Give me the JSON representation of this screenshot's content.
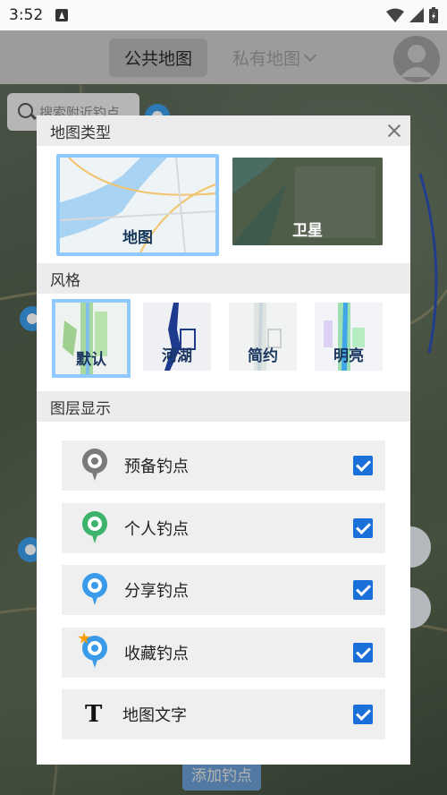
{
  "status_bar": {
    "time": "3:52"
  },
  "top_nav": {
    "tabs": [
      {
        "label": "公共地图",
        "selected": true
      },
      {
        "label": "私有地图",
        "selected": false
      }
    ]
  },
  "map": {
    "search_placeholder": "搜索附近钓点",
    "add_spot_label": "添加钓点"
  },
  "dialog": {
    "map_type_title": "地图类型",
    "map_types": [
      {
        "label": "地图",
        "selected": true
      },
      {
        "label": "卫星",
        "selected": false
      }
    ],
    "style_title": "风格",
    "styles": [
      {
        "label": "默认",
        "selected": true
      },
      {
        "label": "河湖",
        "selected": false
      },
      {
        "label": "简约",
        "selected": false
      },
      {
        "label": "明亮",
        "selected": false
      }
    ],
    "layer_title": "图层显示",
    "layers": [
      {
        "label": "预备钓点",
        "checked": true,
        "icon": "reserve-spot-pin-icon",
        "color": "#7a7a7a"
      },
      {
        "label": "个人钓点",
        "checked": true,
        "icon": "personal-spot-pin-icon",
        "color": "#3db36c"
      },
      {
        "label": "分享钓点",
        "checked": true,
        "icon": "shared-spot-pin-icon",
        "color": "#3a9bea"
      },
      {
        "label": "收藏钓点",
        "checked": true,
        "icon": "favorite-spot-pin-icon",
        "color": "#3a9bea"
      },
      {
        "label": "地图文字",
        "checked": true,
        "icon": "map-text-icon"
      }
    ]
  },
  "colors": {
    "accent": "#1b6fd9",
    "selection_border": "#8fc9ff"
  }
}
